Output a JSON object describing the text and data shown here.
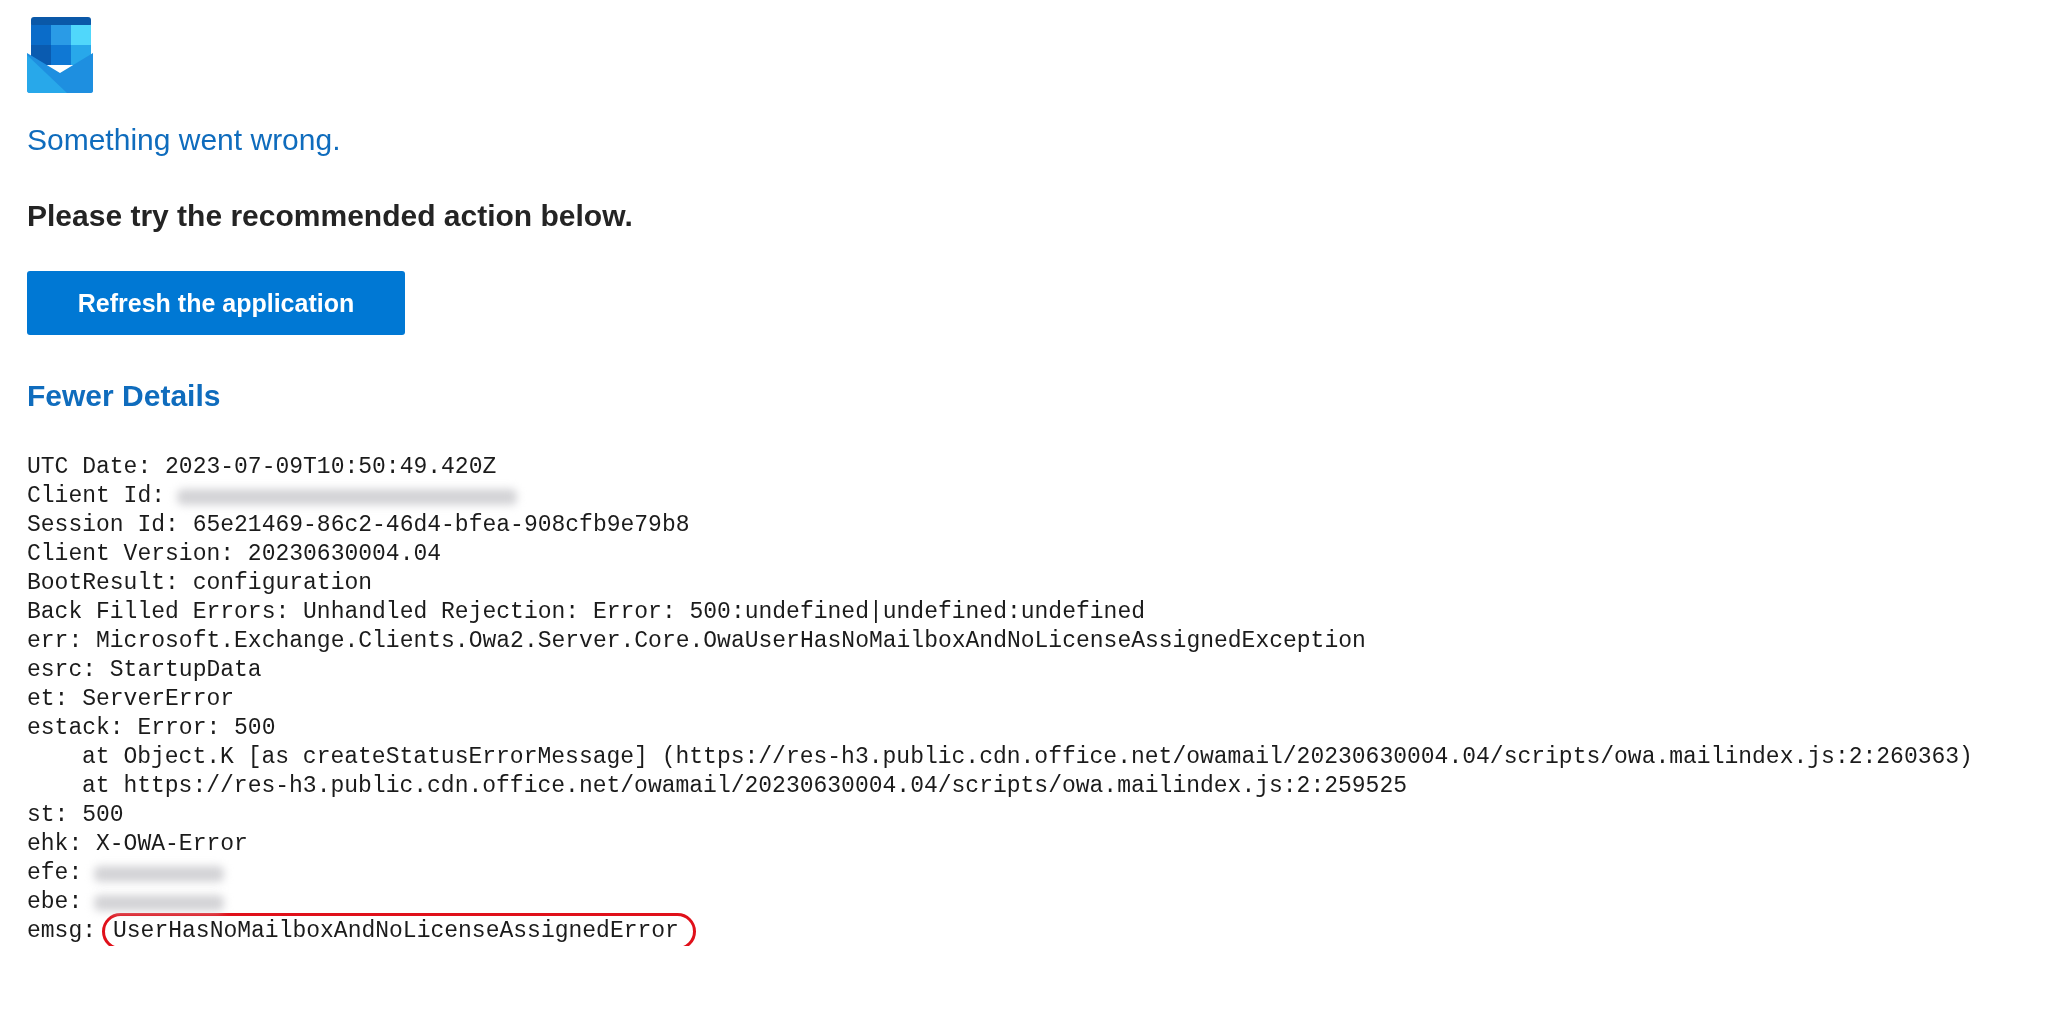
{
  "message": {
    "title": "Something went wrong.",
    "instruction": "Please try the recommended action below."
  },
  "action_button": "Refresh the application",
  "details_toggle": {
    "label": "Fewer Details",
    "expanded": true
  },
  "details": [
    {
      "kind": "entry",
      "text": "UTC Date: 2023-07-09T10:50:49.420Z"
    },
    {
      "kind": "redacted",
      "text": "Client Id:"
    },
    {
      "kind": "entry",
      "text": "Session Id: 65e21469-86c2-46d4-bfea-908cfb9e79b8"
    },
    {
      "kind": "entry",
      "text": "Client Version: 20230630004.04"
    },
    {
      "kind": "entry",
      "text": "BootResult: configuration"
    },
    {
      "kind": "entry",
      "text": "Back Filled Errors: Unhandled Rejection: Error: 500:undefined|undefined:undefined"
    },
    {
      "kind": "entry",
      "text": "err: Microsoft.Exchange.Clients.Owa2.Server.Core.OwaUserHasNoMailboxAndNoLicenseAssignedException"
    },
    {
      "kind": "entry",
      "text": "esrc: StartupData"
    },
    {
      "kind": "entry",
      "text": "et: ServerError"
    },
    {
      "kind": "entry",
      "text": "estack: Error: 500"
    },
    {
      "kind": "frame",
      "text": "at Object.K [as createStatusErrorMessage] (https://res-h3.public.cdn.office.net/owamail/20230630004.04/scripts/owa.mailindex.js:2:260363)"
    },
    {
      "kind": "frame",
      "text": "at https://res-h3.public.cdn.office.net/owamail/20230630004.04/scripts/owa.mailindex.js:2:259525"
    },
    {
      "kind": "entry",
      "text": "st: 500"
    },
    {
      "kind": "entry",
      "text": "ehk: X-OWA-Error"
    },
    {
      "kind": "redacted",
      "text": "efe:"
    },
    {
      "kind": "redacted",
      "text": "ebe:"
    },
    {
      "kind": "circled",
      "text": "emsg:",
      "value": "UserHasNoMailboxAndNoLicenseAssignedError"
    }
  ]
}
